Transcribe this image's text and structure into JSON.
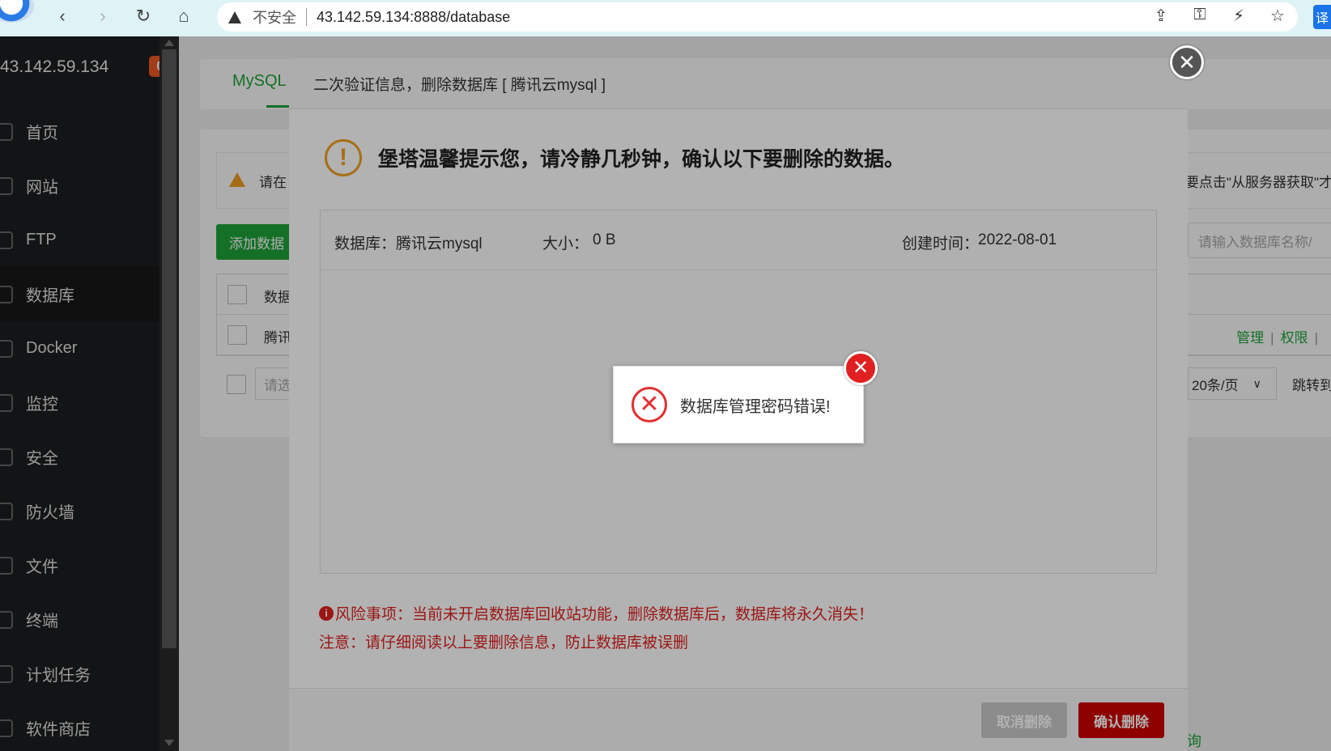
{
  "browser": {
    "security_label": "不安全",
    "url": "43.142.59.134:8888/database",
    "translate_label": "译"
  },
  "sidebar": {
    "server_ip": "43.142.59.134",
    "badge_count": "0",
    "items": [
      {
        "label": "首页"
      },
      {
        "label": "网站"
      },
      {
        "label": "FTP"
      },
      {
        "label": "数据库"
      },
      {
        "label": "Docker"
      },
      {
        "label": "监控"
      },
      {
        "label": "安全"
      },
      {
        "label": "防火墙"
      },
      {
        "label": "文件"
      },
      {
        "label": "终端"
      },
      {
        "label": "计划任务"
      },
      {
        "label": "软件商店"
      }
    ]
  },
  "main": {
    "tab_label": "MySQL",
    "alert_text": "请在",
    "alert_right": "要点击\"从服务器获取\"才",
    "add_button": "添加数据",
    "search_placeholder": "请输入数据库名称/",
    "table_header": "数据",
    "table_row": "腾讯",
    "ops": {
      "manage": "管理",
      "perm": "权限"
    },
    "batch_placeholder": "请选",
    "page_size": "20条/页",
    "jump_label": "跳转到",
    "bottom_link": "正版查询"
  },
  "modal": {
    "title": "二次验证信息，删除数据库 [ 腾讯云mysql ]",
    "tip_text": "堡塔温馨提示您，请冷静几秒钟，确认以下要删除的数据。",
    "db_label": "数据库：腾讯云mysql",
    "size_label": "大小：",
    "size_value": "0 B",
    "created_label": "创建时间：",
    "created_value": "2022-08-01",
    "risk_text": "风险事项：当前未开启数据库回收站功能，删除数据库后，数据库将永久消失！",
    "note_text": "注意：请仔细阅读以上要删除信息，防止数据库被误删",
    "cancel_label": "取消删除",
    "confirm_label": "确认删除"
  },
  "toast": {
    "message": "数据库管理密码错误!"
  },
  "colors": {
    "accent_green": "#20a53a",
    "danger_red": "#cc0000",
    "warning_orange": "#f0a020"
  }
}
